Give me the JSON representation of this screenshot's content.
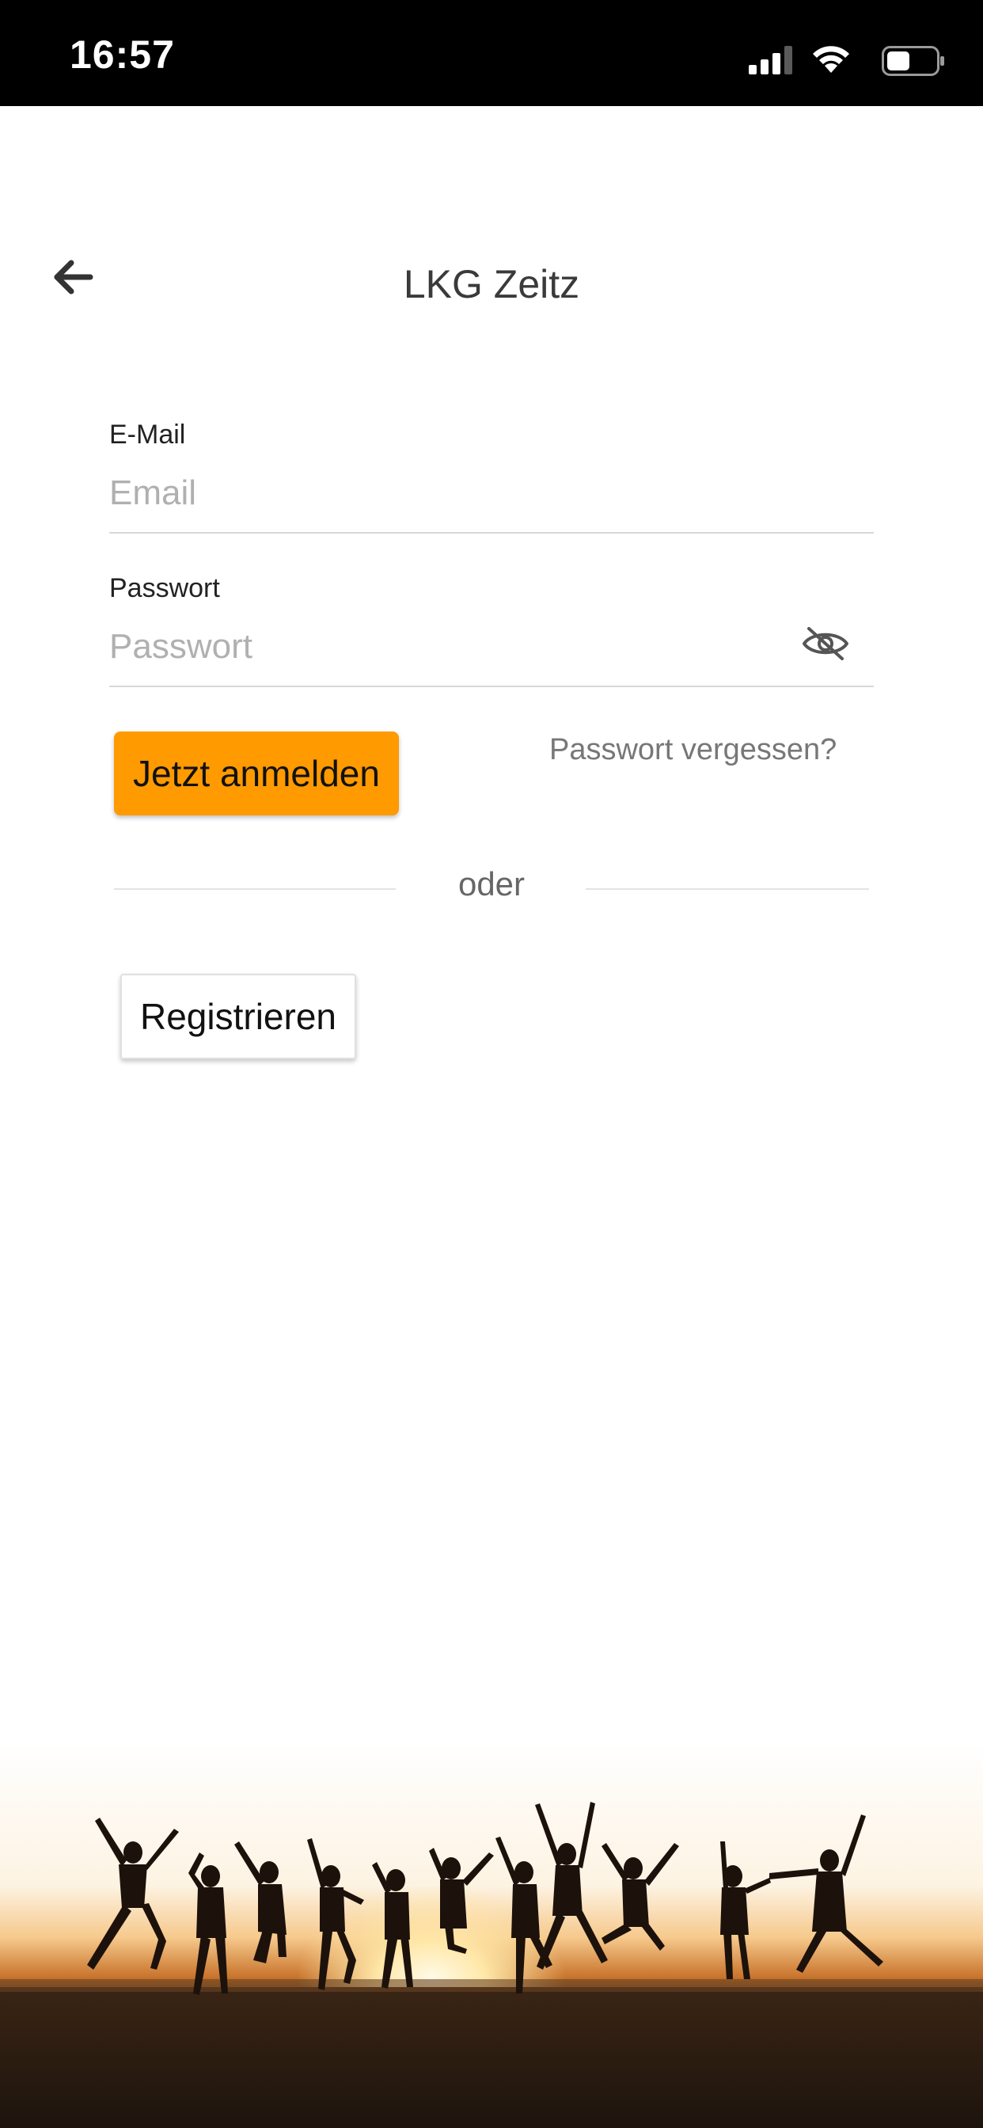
{
  "status_bar": {
    "time": "16:57",
    "icons": [
      "signal-icon",
      "wifi-icon",
      "battery-icon"
    ]
  },
  "header": {
    "back_icon": "arrow-left-icon",
    "title": "LKG Zeitz"
  },
  "form": {
    "email_label": "E-Mail",
    "email_placeholder": "Email",
    "email_value": "",
    "password_label": "Passwort",
    "password_placeholder": "Passwort",
    "password_value": "",
    "password_toggle_icon": "eye-off-icon"
  },
  "actions": {
    "login_label": "Jetzt anmelden",
    "forgot_label": "Passwort vergessen?",
    "divider_label": "oder",
    "register_label": "Registrieren"
  },
  "banner": {
    "image": "people-jumping-silhouette-sunset"
  },
  "colors": {
    "accent": "#ff9a00",
    "status_bar": "#000000",
    "background": "#ffffff"
  }
}
